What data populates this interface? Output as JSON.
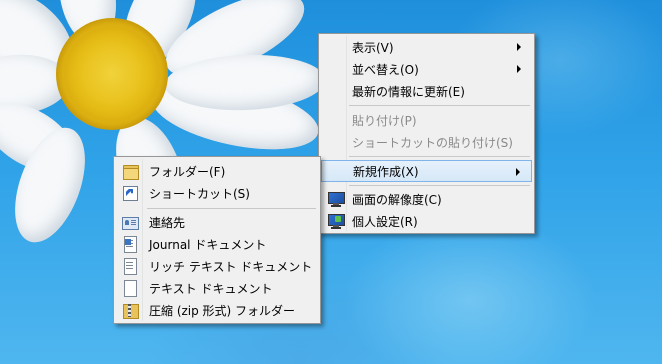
{
  "context_menu": {
    "items": [
      {
        "label": "表示(V)",
        "has_submenu": true,
        "enabled": true
      },
      {
        "label": "並べ替え(O)",
        "has_submenu": true,
        "enabled": true
      },
      {
        "label": "最新の情報に更新(E)",
        "has_submenu": false,
        "enabled": true
      },
      {
        "label": "貼り付け(P)",
        "has_submenu": false,
        "enabled": false
      },
      {
        "label": "ショートカットの貼り付け(S)",
        "has_submenu": false,
        "enabled": false
      },
      {
        "label": "新規作成(X)",
        "has_submenu": true,
        "enabled": true,
        "highlighted": true
      },
      {
        "label": "画面の解像度(C)",
        "has_submenu": false,
        "enabled": true,
        "icon": "monitor-icon"
      },
      {
        "label": "個人設定(R)",
        "has_submenu": false,
        "enabled": true,
        "icon": "personalize-icon"
      }
    ]
  },
  "new_submenu": {
    "items": [
      {
        "label": "フォルダー(F)",
        "icon": "folder-icon"
      },
      {
        "label": "ショートカット(S)",
        "icon": "shortcut-icon"
      },
      {
        "label": "連絡先",
        "icon": "contact-icon"
      },
      {
        "label": "Journal ドキュメント",
        "icon": "journal-document-icon"
      },
      {
        "label": "リッチ テキスト ドキュメント",
        "icon": "rich-text-document-icon"
      },
      {
        "label": "テキスト ドキュメント",
        "icon": "text-document-icon"
      },
      {
        "label": "圧縮 (zip 形式) フォルダー",
        "icon": "zip-folder-icon"
      }
    ]
  },
  "colors": {
    "menu_background": "#f0f0f0",
    "highlight_background": "#d6e8f8",
    "highlight_border": "#7eb4ea",
    "disabled_text": "#8a8a8a",
    "desktop_blue": "#2fa2e8"
  }
}
